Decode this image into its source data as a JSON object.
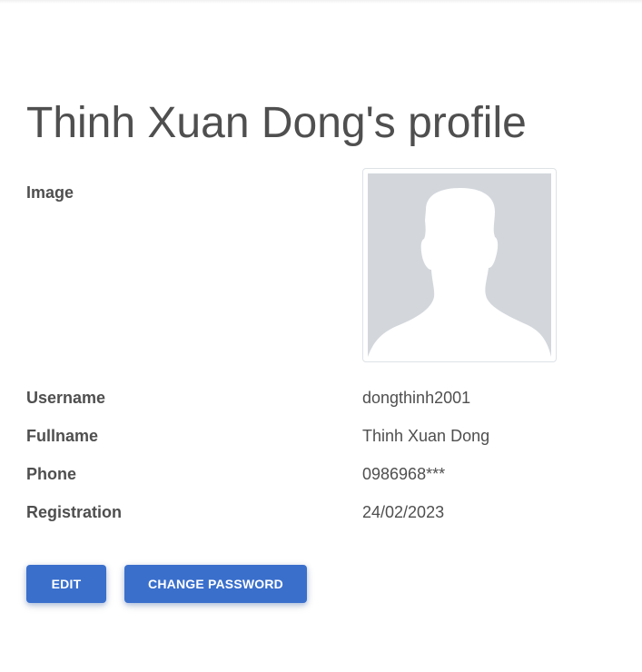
{
  "profile": {
    "title": "Thinh Xuan Dong's profile",
    "fields": {
      "image_label": "Image",
      "username_label": "Username",
      "username_value": "dongthinh2001",
      "fullname_label": "Fullname",
      "fullname_value": "Thinh Xuan Dong",
      "phone_label": "Phone",
      "phone_value": "0986968***",
      "registration_label": "Registration",
      "registration_value": "24/02/2023"
    },
    "avatar_icon": "default-user-silhouette-icon"
  },
  "actions": {
    "edit_label": "EDIT",
    "change_password_label": "CHANGE PASSWORD"
  },
  "colors": {
    "primary": "#3a6fcc",
    "text": "#4f4f4f",
    "avatar_bg": "#d3d7dc"
  }
}
